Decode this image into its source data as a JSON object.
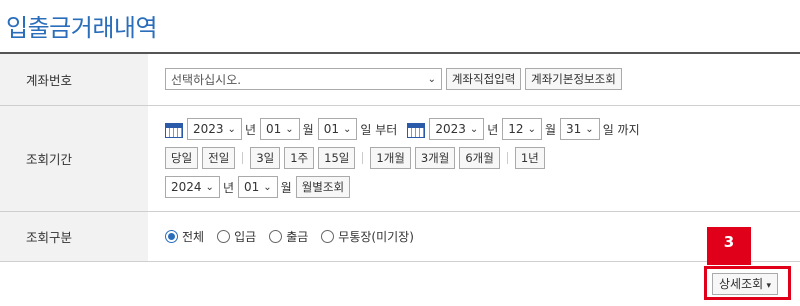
{
  "page": {
    "title": "입출금거래내역"
  },
  "account": {
    "label": "계좌번호",
    "select_value": "선택하십시오.",
    "direct_input_button": "계좌직접입력",
    "basic_info_button": "계좌기본정보조회"
  },
  "period": {
    "label": "조회기간",
    "start": {
      "year": "2023",
      "month": "01",
      "day": "01"
    },
    "end": {
      "year": "2023",
      "month": "12",
      "day": "31"
    },
    "unit_year": "년",
    "unit_month": "월",
    "unit_day_from": "일 부터",
    "unit_day_to": "일 까지",
    "quick_buttons": {
      "today": "당일",
      "prev_day": "전일",
      "3d": "3일",
      "1w": "1주",
      "15d": "15일",
      "1m": "1개월",
      "3m": "3개월",
      "6m": "6개월",
      "1y": "1년"
    },
    "monthly": {
      "year": "2024",
      "month": "01",
      "button": "월별조회"
    }
  },
  "type": {
    "label": "조회구분",
    "options": [
      "전체",
      "입금",
      "출금",
      "무통장(미기장)"
    ],
    "selected": "전체"
  },
  "detail_button": "상세조회",
  "annotation": {
    "step": "3",
    "color": "#e0001a"
  },
  "colors": {
    "title": "#2a6ebb",
    "radio_selected": "#2a6ebb"
  }
}
